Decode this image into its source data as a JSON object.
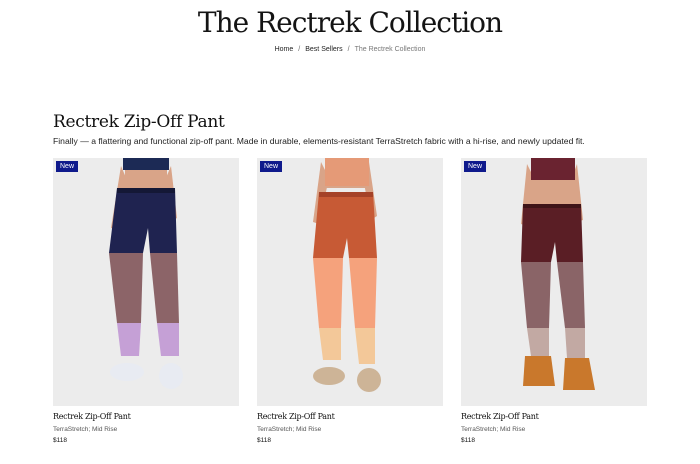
{
  "page": {
    "title": "The Rectrek Collection"
  },
  "breadcrumb": {
    "home": "Home",
    "sep": "/",
    "best_sellers": "Best Sellers",
    "current": "The Rectrek Collection"
  },
  "collection": {
    "title": "Rectrek Zip-Off Pant",
    "description": "Finally — a flattering and functional zip-off pant. Made in durable, elements-resistant TerraStretch fabric with a hi-rise, and newly updated fit."
  },
  "products": [
    {
      "badge": "New",
      "name": "Rectrek Zip-Off Pant",
      "subtitle": "TerraStretch; Mid Rise",
      "price": "$118",
      "colors": {
        "top": "#1f2350",
        "bottom": "#8c6468",
        "cuff": "#c5a0d6",
        "shoe": "#e8ebf2",
        "crop": "#1c2a55"
      }
    },
    {
      "badge": "New",
      "name": "Rectrek Zip-Off Pant",
      "subtitle": "TerraStretch; Mid Rise",
      "price": "$118",
      "colors": {
        "top": "#c75a35",
        "bottom": "#f5a27c",
        "cuff": "#f3c899",
        "shoe": "#cdb497",
        "crop": "#e59a77"
      }
    },
    {
      "badge": "New",
      "name": "Rectrek Zip-Off Pant",
      "subtitle": "TerraStretch; Mid Rise",
      "price": "$118",
      "colors": {
        "top": "#5a1e25",
        "bottom": "#8a6467",
        "cuff": "#c2a9a3",
        "shoe": "#c9782c",
        "crop": "#6a2330"
      }
    }
  ]
}
